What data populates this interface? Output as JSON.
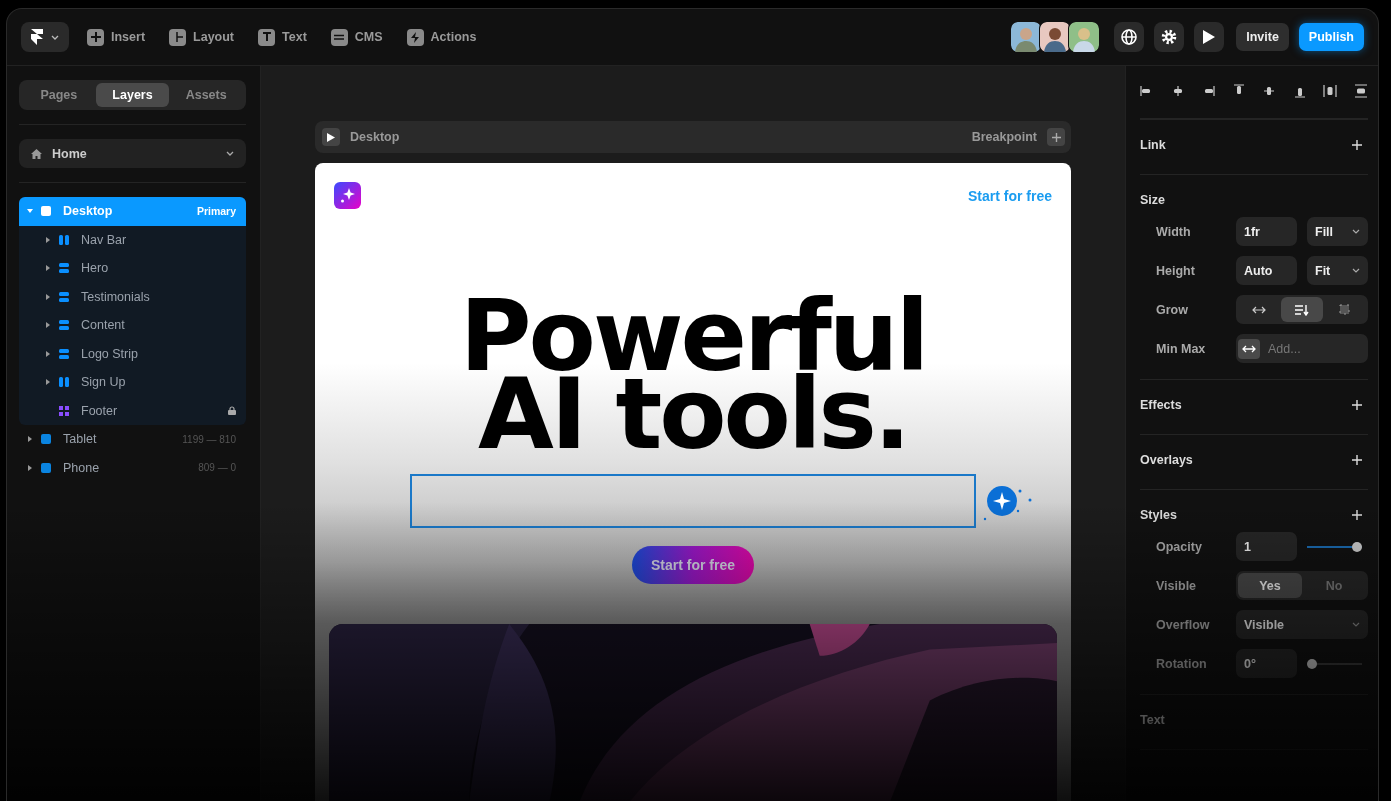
{
  "toolbar": {
    "menu": [
      {
        "label": "Insert",
        "kind": "plus"
      },
      {
        "label": "Layout",
        "kind": "layout"
      },
      {
        "label": "Text",
        "kind": "text"
      },
      {
        "label": "CMS",
        "kind": "database"
      },
      {
        "label": "Actions",
        "kind": "bolt"
      }
    ],
    "buttons": [
      {
        "label": "Invite",
        "primary": false
      },
      {
        "label": "Publish",
        "primary": true
      }
    ]
  },
  "left_panel": {
    "tabs": [
      {
        "label": "Pages",
        "selected": false
      },
      {
        "label": "Layers",
        "selected": true
      },
      {
        "label": "Assets",
        "selected": false
      }
    ],
    "page_select": {
      "value": "Home"
    },
    "layers": [
      {
        "name": "Desktop",
        "kind": "frame",
        "badge": "Primary",
        "selected": true,
        "expandable": true,
        "expanded": true,
        "locked": false,
        "children": [
          {
            "name": "Nav Bar",
            "kind": "row",
            "selected": false,
            "expandable": true,
            "expanded": false,
            "locked": false
          },
          {
            "name": "Hero",
            "kind": "column",
            "selected": false,
            "expandable": true,
            "expanded": false,
            "locked": false
          },
          {
            "name": "Testimonials",
            "kind": "column",
            "selected": false,
            "expandable": true,
            "expanded": false,
            "locked": false
          },
          {
            "name": "Content",
            "kind": "column",
            "selected": false,
            "expandable": true,
            "expanded": false,
            "locked": false
          },
          {
            "name": "Logo Strip",
            "kind": "column",
            "selected": false,
            "expandable": true,
            "expanded": false,
            "locked": false
          },
          {
            "name": "Sign Up",
            "kind": "row",
            "selected": false,
            "expandable": true,
            "expanded": false,
            "locked": false
          },
          {
            "name": "Footer",
            "kind": "grid",
            "selected": false,
            "expandable": false,
            "locked": true
          }
        ]
      },
      {
        "name": "Tablet",
        "kind": "frame",
        "size": "1199 — 810",
        "selected": false,
        "expandable": true,
        "expanded": false,
        "locked": false
      },
      {
        "name": "Phone",
        "kind": "frame",
        "size": "809 — 0",
        "selected": false,
        "expandable": true,
        "expanded": false,
        "locked": false
      }
    ]
  },
  "canvas": {
    "breakpoint_bar": {
      "title": "Desktop",
      "action": "Breakpoint"
    },
    "frame": {
      "nav_link": "Start for free",
      "heading": "Powerful AI tools.",
      "input": {
        "selected": true
      },
      "button": "Start for free"
    }
  },
  "right_panel": {
    "sections": [
      {
        "title": "Link",
        "addable": true
      },
      {
        "title": "Size",
        "addable": false,
        "rows": [
          {
            "label": "Width",
            "kind": "value-select",
            "value": "1fr",
            "option": "Fill"
          },
          {
            "label": "Height",
            "kind": "value-select",
            "value": "Auto",
            "option": "Fit"
          },
          {
            "label": "Grow",
            "kind": "segments",
            "options": [
              {
                "selected": false
              },
              {
                "selected": true
              },
              {
                "selected": false
              }
            ]
          },
          {
            "label": "Min Max",
            "kind": "add",
            "placeholder": "Add..."
          }
        ]
      },
      {
        "title": "Effects",
        "addable": true
      },
      {
        "title": "Overlays",
        "addable": true
      },
      {
        "title": "Styles",
        "addable": true,
        "rows": [
          {
            "label": "Opacity",
            "kind": "value-slider",
            "value": "1",
            "level": 1
          },
          {
            "label": "Visible",
            "kind": "toggle",
            "options": [
              {
                "label": "Yes",
                "selected": true
              },
              {
                "label": "No",
                "selected": false
              }
            ]
          },
          {
            "label": "Overflow",
            "kind": "select",
            "value": "Visible"
          },
          {
            "label": "Rotation",
            "kind": "value-slider",
            "value": "0°",
            "level": 0
          }
        ]
      },
      {
        "title": "Text",
        "addable": false
      }
    ]
  }
}
